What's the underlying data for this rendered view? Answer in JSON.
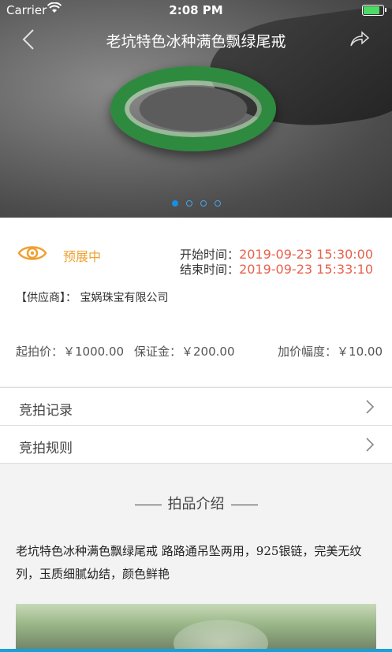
{
  "status_bar": {
    "carrier": "Carrier",
    "time": "2:08 PM"
  },
  "nav": {
    "title": "老坑特色冰种满色飘绿尾戒"
  },
  "carousel": {
    "count": 4,
    "active_index": 0
  },
  "auction": {
    "status": "预展中",
    "start_label": "开始时间：",
    "start_value": "2019-09-23 15:30:00",
    "end_label": "结束时间：",
    "end_value": "2019-09-23 15:33:10",
    "supplier": "【供应商】： 宝娲珠宝有限公司",
    "start_price": "起拍价：￥1000.00",
    "deposit": "保证金：￥200.00",
    "increment": "加价幅度：￥10.00"
  },
  "menu": [
    {
      "label": "竞拍记录"
    },
    {
      "label": "竞拍规则"
    }
  ],
  "intro": {
    "title": "拍品介绍",
    "description": "老坑特色冰种满色飘绿尾戒 路路通吊坠两用，925银链，完美无纹列，玉质细腻幼结，颜色鲜艳"
  },
  "colors": {
    "accent_orange": "#f0a030",
    "time_red": "#e8604a",
    "dot_blue": "#1a8fe0"
  }
}
